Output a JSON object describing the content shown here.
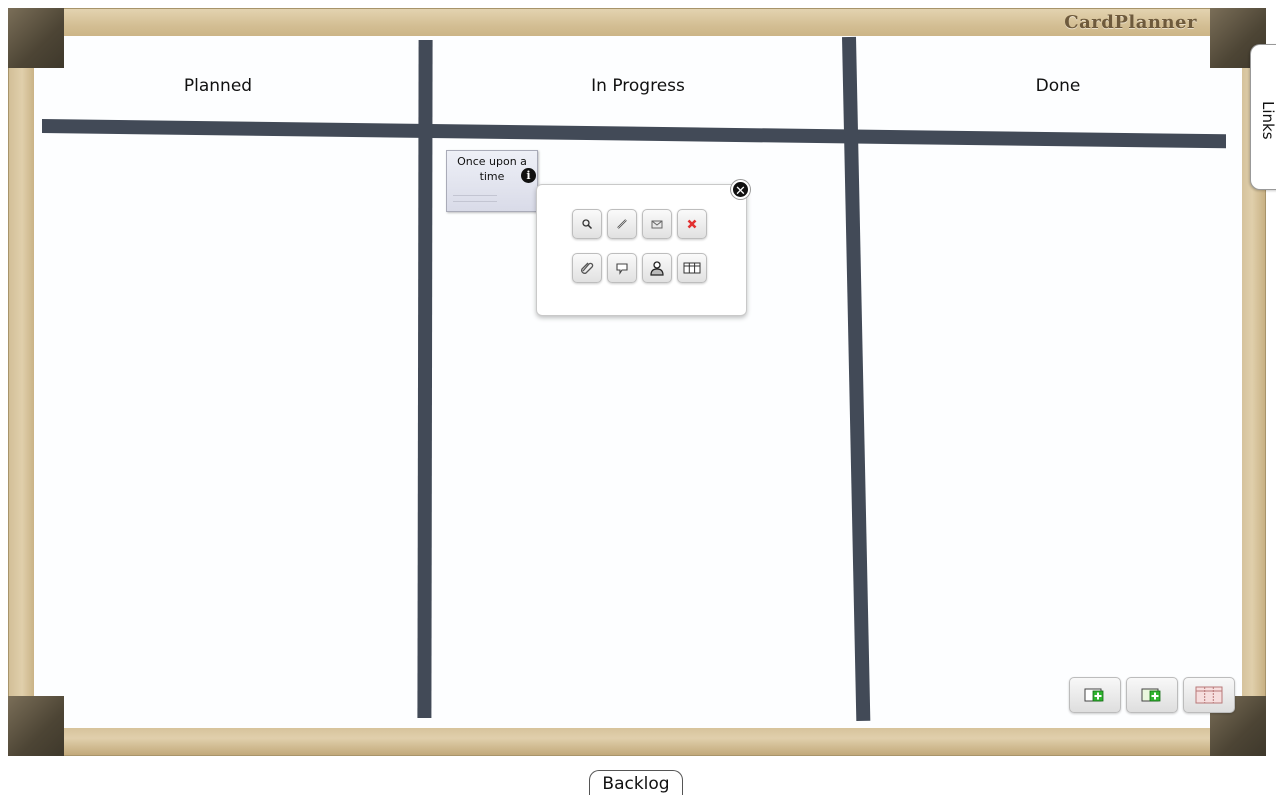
{
  "app": {
    "brand": "CardPlanner"
  },
  "columns": [
    {
      "title": "Planned"
    },
    {
      "title": "In Progress"
    },
    {
      "title": "Done"
    }
  ],
  "card": {
    "title": "Once upon a time",
    "info_icon": "info-icon"
  },
  "popup": {
    "close_icon": "close-icon",
    "actions": [
      {
        "name": "zoom",
        "icon": "magnifier-icon"
      },
      {
        "name": "edit",
        "icon": "pencil-icon"
      },
      {
        "name": "email",
        "icon": "envelope-icon"
      },
      {
        "name": "delete",
        "icon": "red-x-icon"
      },
      {
        "name": "attach",
        "icon": "paperclip-icon"
      },
      {
        "name": "comment",
        "icon": "speech-bubble-icon"
      },
      {
        "name": "assign-user",
        "icon": "user-icon"
      },
      {
        "name": "table",
        "icon": "table-icon"
      }
    ]
  },
  "side_tab": {
    "label": "Links"
  },
  "tools": [
    {
      "name": "add-card",
      "icon": "add-card-icon"
    },
    {
      "name": "add-card-alt",
      "icon": "add-card-icon"
    },
    {
      "name": "columns",
      "icon": "columns-icon"
    }
  ],
  "bottom_tab": {
    "label": "Backlog"
  },
  "colors": {
    "lane_lines": "#424a57",
    "frame": "#cdb88d",
    "delete_red": "#e23131",
    "add_green": "#2fb52f"
  }
}
